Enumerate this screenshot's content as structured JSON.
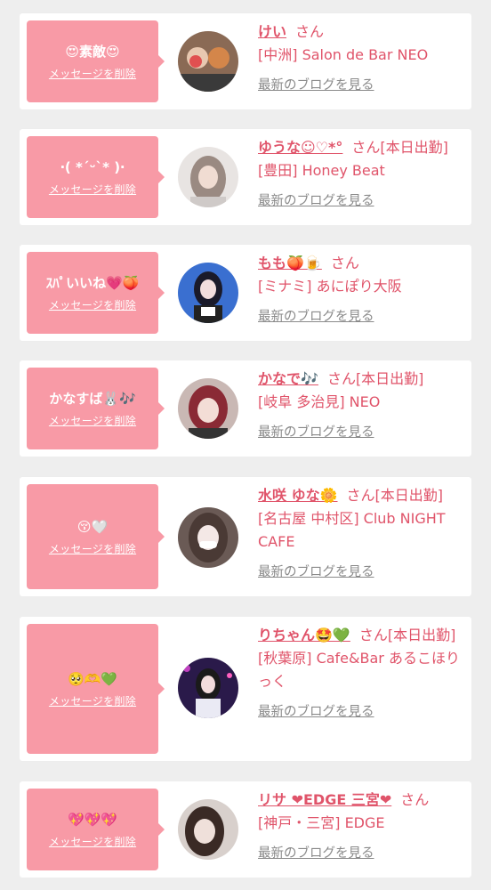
{
  "cards": [
    {
      "message": "😍素敵😍",
      "delete_label": "メッセージを削除",
      "name": "けい",
      "san": "さん",
      "shop": "[中洲] Salon de Bar NEO",
      "blog": "最新のブログを見る"
    },
    {
      "message": "‧( *ˊᵕˋ* )‧",
      "delete_label": "メッセージを削除",
      "name": "ゆうな☺︎♡*°",
      "san": "さん[本日出勤]",
      "shop": "[豊田] Honey Beat",
      "blog": "最新のブログを見る"
    },
    {
      "message": "ｽﾊﾟいいね💗🍑",
      "delete_label": "メッセージを削除",
      "name": "もも🍑🍺",
      "san": "さん",
      "shop": "[ミナミ] あにぽり大阪",
      "blog": "最新のブログを見る"
    },
    {
      "message": "かなすば🐰🎶",
      "delete_label": "メッセージを削除",
      "name": "かなで🎶",
      "san": "さん[本日出勤]",
      "shop": "[岐阜 多治見] NEO",
      "blog": "最新のブログを見る"
    },
    {
      "message": "😚🤍",
      "delete_label": "メッセージを削除",
      "name": "水咲 ゆな🌼",
      "san": "さん[本日出勤]",
      "shop": "[名古屋 中村区] Club NIGHT CAFE",
      "blog": "最新のブログを見る"
    },
    {
      "message": "🥺🫶💚",
      "delete_label": "メッセージを削除",
      "name": "りちゃん🤩💚",
      "san": "さん[本日出勤]",
      "shop": "[秋葉原] Cafe&Bar あるこほりっく",
      "blog": "最新のブログを見る"
    },
    {
      "message": "💖💖💖",
      "delete_label": "メッセージを削除",
      "name": "リサ ❤EDGE 三宮❤",
      "san": "さん",
      "shop": "[神戸・三宮] EDGE",
      "blog": "最新のブログを見る"
    }
  ],
  "colors": {
    "accent": "#e0546a",
    "bubble": "#f89aa6",
    "background": "#eeeeee",
    "link_gray": "#8a8a8a"
  },
  "icons": [
    "avatar-photo"
  ]
}
